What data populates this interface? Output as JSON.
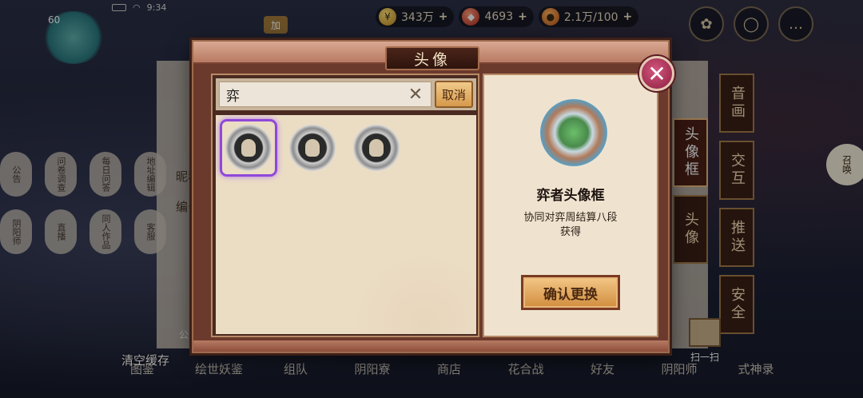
{
  "status_bar": {
    "time": "9:34"
  },
  "top_resources": [
    {
      "icon": "coin-icon",
      "glyph": "¥",
      "value": "343万"
    },
    {
      "icon": "jade-icon",
      "glyph": "◆",
      "value": "4693"
    },
    {
      "icon": "stamina-icon",
      "glyph": "●",
      "value": "2.1万/100"
    }
  ],
  "player": {
    "level": "60",
    "add_label": "加"
  },
  "background_panel": {
    "nickname_label": "昵称",
    "id_label": "编号",
    "lanterns": [
      "公告",
      "问卷调查",
      "每日问答",
      "地址编辑",
      "阴阳师",
      "直播",
      "同人作品",
      "客服"
    ],
    "clear_cache": "清空缓存",
    "public_label": "公众"
  },
  "bottom_nav": [
    "图鉴",
    "绘世妖鉴",
    "组队",
    "阴阳寮",
    "商店",
    "花合战",
    "好友",
    "阴阳师",
    "式神录"
  ],
  "settings_tabs": [
    {
      "label": "音画",
      "active": false
    },
    {
      "label": "头像框",
      "active": true
    },
    {
      "label": "交互",
      "active": false
    },
    {
      "label": "头像",
      "active": false
    },
    {
      "label": "推送",
      "active": false
    },
    {
      "label": "安全",
      "active": false
    }
  ],
  "summon_label": "召唤",
  "scan_label": "扫一扫",
  "modal": {
    "title": "头像",
    "search": {
      "value": "弈",
      "cancel_label": "取消"
    },
    "frames": [
      {
        "name": "弈者头像框",
        "selected": true
      },
      {
        "name": "frame-2",
        "selected": false
      },
      {
        "name": "frame-3",
        "selected": false
      }
    ],
    "detail": {
      "name": "弈者头像框",
      "desc_line1": "协同对弈周结算八段",
      "desc_line2": "获得",
      "confirm_label": "确认更换"
    }
  },
  "colors": {
    "accent_purple": "#8f48d8",
    "modal_wood": "#6b3a2c",
    "confirm_gold": "#d18d3e"
  }
}
